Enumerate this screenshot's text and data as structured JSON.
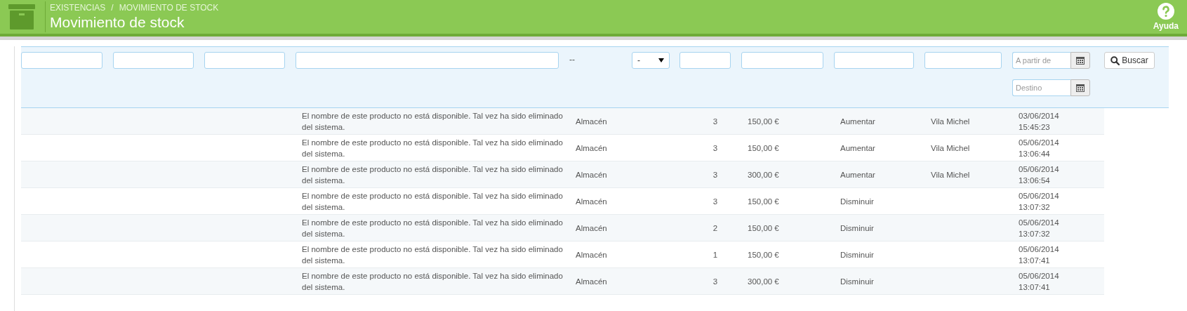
{
  "header": {
    "breadcrumb": [
      "EXISTENCIAS",
      "MOVIMIENTO DE STOCK"
    ],
    "separator": "/",
    "title": "Movimiento de stock",
    "help": "Ayuda"
  },
  "filters": {
    "warehouse": "--",
    "sign": "-",
    "date_from": {
      "placeholder": "A partir de"
    },
    "date_to": {
      "placeholder": "Destino"
    },
    "search_button": "Buscar"
  },
  "rows": [
    {
      "name": "El nombre de este producto no está disponible. Tal vez ha sido eliminado del sistema.",
      "warehouse": "Almacén",
      "quantity": "3",
      "price": "150,00 €",
      "label": "Aumentar",
      "employee": "Vila Michel",
      "date": "03/06/2014",
      "time": "15:45:23"
    },
    {
      "name": "El nombre de este producto no está disponible. Tal vez ha sido eliminado del sistema.",
      "warehouse": "Almacén",
      "quantity": "3",
      "price": "150,00 €",
      "label": "Aumentar",
      "employee": "Vila Michel",
      "date": "05/06/2014",
      "time": "13:06:44"
    },
    {
      "name": "El nombre de este producto no está disponible. Tal vez ha sido eliminado del sistema.",
      "warehouse": "Almacén",
      "quantity": "3",
      "price": "300,00 €",
      "label": "Aumentar",
      "employee": "Vila Michel",
      "date": "05/06/2014",
      "time": "13:06:54"
    },
    {
      "name": "El nombre de este producto no está disponible. Tal vez ha sido eliminado del sistema.",
      "warehouse": "Almacén",
      "quantity": "3",
      "price": "150,00 €",
      "label": "Disminuir",
      "date": "05/06/2014",
      "time": "13:07:32"
    },
    {
      "name": "El nombre de este producto no está disponible. Tal vez ha sido eliminado del sistema.",
      "warehouse": "Almacén",
      "quantity": "2",
      "price": "150,00 €",
      "label": "Disminuir",
      "date": "05/06/2014",
      "time": "13:07:32"
    },
    {
      "name": "El nombre de este producto no está disponible. Tal vez ha sido eliminado del sistema.",
      "warehouse": "Almacén",
      "quantity": "1",
      "price": "150,00 €",
      "label": "Disminuir",
      "date": "05/06/2014",
      "time": "13:07:41"
    },
    {
      "name": "El nombre de este producto no está disponible. Tal vez ha sido eliminado del sistema.",
      "warehouse": "Almacén",
      "quantity": "3",
      "price": "300,00 €",
      "label": "Disminuir",
      "date": "05/06/2014",
      "time": "13:07:41"
    }
  ]
}
